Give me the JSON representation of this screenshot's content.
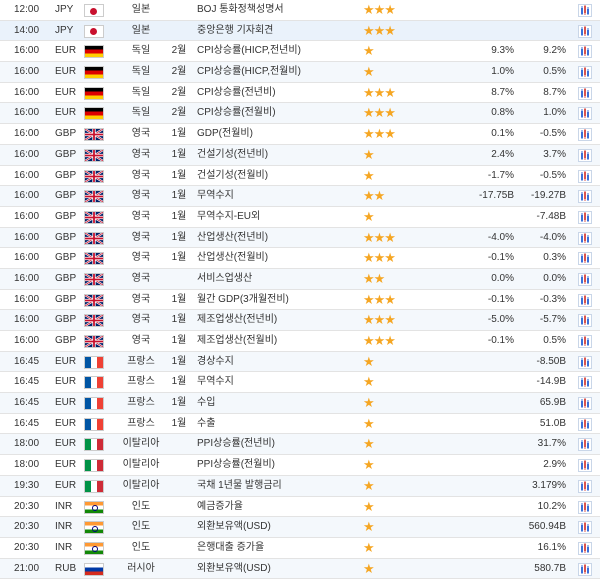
{
  "colors": {
    "star": "#f5a623",
    "chart_blue": "#3b6fd8",
    "chart_red": "#d9534f"
  },
  "icons": {
    "flag": "flag-icon",
    "chart": "chart-icon",
    "star": "star-icon"
  },
  "rows": [
    {
      "time": "12:00",
      "currency": "JPY",
      "flag": "jp",
      "country": "일본",
      "period": "",
      "event": "BOJ 통화정책성명서",
      "stars": 3,
      "actual": "",
      "forecast": ""
    },
    {
      "time": "14:00",
      "currency": "JPY",
      "flag": "jp",
      "country": "일본",
      "period": "",
      "event": "중앙은행 기자회견",
      "stars": 3,
      "actual": "",
      "forecast": ""
    },
    {
      "time": "16:00",
      "currency": "EUR",
      "flag": "de",
      "country": "독일",
      "period": "2월",
      "event": "CPI상승률(HICP,전년비)",
      "stars": 1,
      "actual": "9.3%",
      "forecast": "9.2%"
    },
    {
      "time": "16:00",
      "currency": "EUR",
      "flag": "de",
      "country": "독일",
      "period": "2월",
      "event": "CPI상승률(HICP,전월비)",
      "stars": 1,
      "actual": "1.0%",
      "forecast": "0.5%"
    },
    {
      "time": "16:00",
      "currency": "EUR",
      "flag": "de",
      "country": "독일",
      "period": "2월",
      "event": "CPI상승률(전년비)",
      "stars": 3,
      "actual": "8.7%",
      "forecast": "8.7%"
    },
    {
      "time": "16:00",
      "currency": "EUR",
      "flag": "de",
      "country": "독일",
      "period": "2월",
      "event": "CPI상승률(전월비)",
      "stars": 3,
      "actual": "0.8%",
      "forecast": "1.0%"
    },
    {
      "time": "16:00",
      "currency": "GBP",
      "flag": "gb",
      "country": "영국",
      "period": "1월",
      "event": "GDP(전월비)",
      "stars": 3,
      "actual": "0.1%",
      "forecast": "-0.5%"
    },
    {
      "time": "16:00",
      "currency": "GBP",
      "flag": "gb",
      "country": "영국",
      "period": "1월",
      "event": "건설기성(전년비)",
      "stars": 1,
      "actual": "2.4%",
      "forecast": "3.7%"
    },
    {
      "time": "16:00",
      "currency": "GBP",
      "flag": "gb",
      "country": "영국",
      "period": "1월",
      "event": "건설기성(전월비)",
      "stars": 1,
      "actual": "-1.7%",
      "forecast": "-0.5%"
    },
    {
      "time": "16:00",
      "currency": "GBP",
      "flag": "gb",
      "country": "영국",
      "period": "1월",
      "event": "무역수지",
      "stars": 2,
      "actual": "-17.75B",
      "forecast": "-19.27B"
    },
    {
      "time": "16:00",
      "currency": "GBP",
      "flag": "gb",
      "country": "영국",
      "period": "1월",
      "event": "무역수지-EU외",
      "stars": 1,
      "actual": "",
      "forecast": "-7.48B"
    },
    {
      "time": "16:00",
      "currency": "GBP",
      "flag": "gb",
      "country": "영국",
      "period": "1월",
      "event": "산업생산(전년비)",
      "stars": 3,
      "actual": "-4.0%",
      "forecast": "-4.0%"
    },
    {
      "time": "16:00",
      "currency": "GBP",
      "flag": "gb",
      "country": "영국",
      "period": "1월",
      "event": "산업생산(전월비)",
      "stars": 3,
      "actual": "-0.1%",
      "forecast": "0.3%"
    },
    {
      "time": "16:00",
      "currency": "GBP",
      "flag": "gb",
      "country": "영국",
      "period": "",
      "event": "서비스업생산",
      "stars": 2,
      "actual": "0.0%",
      "forecast": "0.0%"
    },
    {
      "time": "16:00",
      "currency": "GBP",
      "flag": "gb",
      "country": "영국",
      "period": "1월",
      "event": "월간 GDP(3개월전비)",
      "stars": 3,
      "actual": "-0.1%",
      "forecast": "-0.3%"
    },
    {
      "time": "16:00",
      "currency": "GBP",
      "flag": "gb",
      "country": "영국",
      "period": "1월",
      "event": "제조업생산(전년비)",
      "stars": 3,
      "actual": "-5.0%",
      "forecast": "-5.7%"
    },
    {
      "time": "16:00",
      "currency": "GBP",
      "flag": "gb",
      "country": "영국",
      "period": "1월",
      "event": "제조업생산(전월비)",
      "stars": 3,
      "actual": "-0.1%",
      "forecast": "0.5%"
    },
    {
      "time": "16:45",
      "currency": "EUR",
      "flag": "fr",
      "country": "프랑스",
      "period": "1월",
      "event": "경상수지",
      "stars": 1,
      "actual": "",
      "forecast": "-8.50B"
    },
    {
      "time": "16:45",
      "currency": "EUR",
      "flag": "fr",
      "country": "프랑스",
      "period": "1월",
      "event": "무역수지",
      "stars": 1,
      "actual": "",
      "forecast": "-14.9B"
    },
    {
      "time": "16:45",
      "currency": "EUR",
      "flag": "fr",
      "country": "프랑스",
      "period": "1월",
      "event": "수입",
      "stars": 1,
      "actual": "",
      "forecast": "65.9B"
    },
    {
      "time": "16:45",
      "currency": "EUR",
      "flag": "fr",
      "country": "프랑스",
      "period": "1월",
      "event": "수출",
      "stars": 1,
      "actual": "",
      "forecast": "51.0B"
    },
    {
      "time": "18:00",
      "currency": "EUR",
      "flag": "it",
      "country": "이탈리아",
      "period": "",
      "event": "PPI상승률(전년비)",
      "stars": 1,
      "actual": "",
      "forecast": "31.7%"
    },
    {
      "time": "18:00",
      "currency": "EUR",
      "flag": "it",
      "country": "이탈리아",
      "period": "",
      "event": "PPI상승률(전월비)",
      "stars": 1,
      "actual": "",
      "forecast": "2.9%"
    },
    {
      "time": "19:30",
      "currency": "EUR",
      "flag": "it",
      "country": "이탈리아",
      "period": "",
      "event": "국채 1년물 발행금리",
      "stars": 1,
      "actual": "",
      "forecast": "3.179%"
    },
    {
      "time": "20:30",
      "currency": "INR",
      "flag": "in",
      "country": "인도",
      "period": "",
      "event": "예금증가율",
      "stars": 1,
      "actual": "",
      "forecast": "10.2%"
    },
    {
      "time": "20:30",
      "currency": "INR",
      "flag": "in",
      "country": "인도",
      "period": "",
      "event": "외환보유액(USD)",
      "stars": 1,
      "actual": "",
      "forecast": "560.94B"
    },
    {
      "time": "20:30",
      "currency": "INR",
      "flag": "in",
      "country": "인도",
      "period": "",
      "event": "은행대출 증가율",
      "stars": 1,
      "actual": "",
      "forecast": "16.1%"
    },
    {
      "time": "21:00",
      "currency": "RUB",
      "flag": "ru",
      "country": "러시아",
      "period": "",
      "event": "외환보유액(USD)",
      "stars": 1,
      "actual": "",
      "forecast": "580.7B"
    }
  ]
}
